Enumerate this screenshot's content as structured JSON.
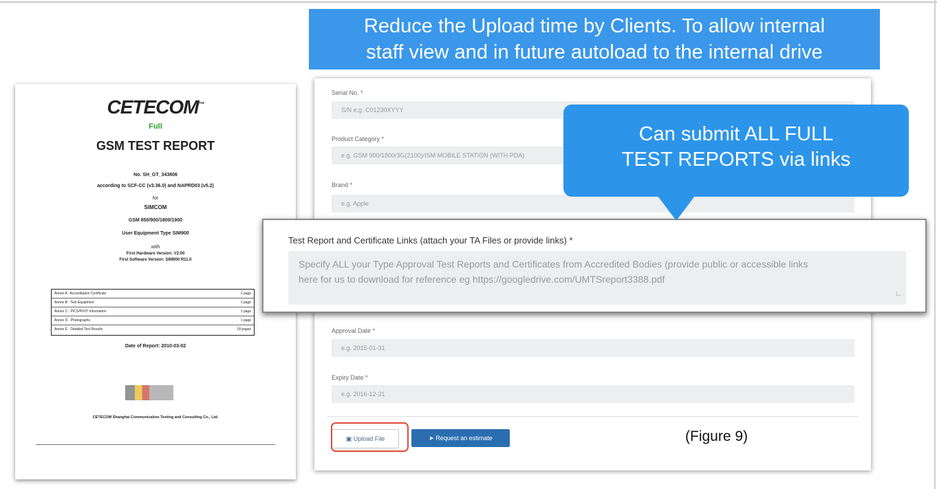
{
  "headline": {
    "line1": "Reduce the Upload time by Clients. To allow internal",
    "line2": "staff view and in future autoload to the internal drive"
  },
  "document": {
    "logo": "CETECOM",
    "logo_tm": "™",
    "badge": "Full",
    "title": "GSM TEST REPORT",
    "report_no": "No. SH_GT_343806",
    "according": "according to SCF-CC (v3.36.0) and NAPRD03 (v5.2)",
    "for": "for",
    "company": "SIMCOM",
    "bands": "GSM 850/900/1800/1900",
    "ue": "User Equipment Type SIM900",
    "with": "with",
    "hw": "First Hardware Version: V2.00",
    "sw": "First Software Version: SIM900 R11.0",
    "annexes": [
      {
        "name": "Annex A - Accreditation Certificate",
        "pages": "1 page"
      },
      {
        "name": "Annex B - Test Equipment",
        "pages": "1 page"
      },
      {
        "name": "Annex C - PICS/PIXIT Information",
        "pages": "1 page"
      },
      {
        "name": "Annex D - Photographs",
        "pages": "1 page"
      },
      {
        "name": "Annex E - Detailed Test Results",
        "pages": "18 pages"
      }
    ],
    "date": "Date of Report: 2010-03-02",
    "footer_company": "CETECOM Shanghai Communication Testing and Consulting Co., Ltd."
  },
  "form": {
    "serial_label": "Serial No. *",
    "serial_placeholder": "S/N e.g. C01230XYYY",
    "category_label": "Product Category *",
    "category_placeholder": "e.g. GSM 900/1800/3G(2100)/ISM MOBILE STATION (WITH PDA)",
    "brand_label": "Brand *",
    "brand_placeholder": "e.g. Apple",
    "approval_label": "Approval Date *",
    "approval_placeholder": "e.g. 2015-01-31",
    "expiry_label": "Expiry Date *",
    "expiry_placeholder": "e.g. 2016-12-31",
    "upload_button": "Upload File",
    "estimate_button": "Request an estimate"
  },
  "highlight": {
    "label": "Test Report and Certificate Links (attach your TA Files or provide links) *",
    "placeholder_line1": "Specify ALL your Type Approval Test Reports and Certificates from Accredited Bodies (provide public or accessible links",
    "placeholder_line2": "here for us to download for reference eg https://googledrive.com/UMTSreport3388.pdf"
  },
  "callout": {
    "line1": "Can submit ALL FULL",
    "line2": "TEST REPORTS via links"
  },
  "figure_caption": "(Figure 9)",
  "colors": {
    "banner": "#3a97ea",
    "callout": "#2c95ea",
    "primary_button": "#2b6eb0",
    "upload_ring": "#e04a3a"
  }
}
